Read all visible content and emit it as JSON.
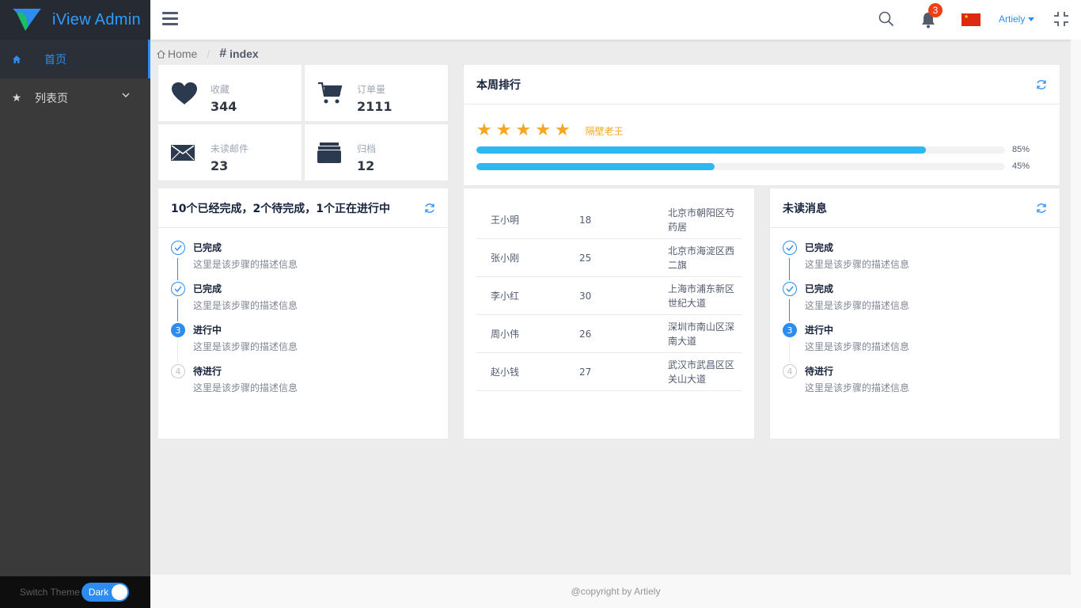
{
  "app": {
    "logo_text": "iView Admin"
  },
  "sidebar": {
    "items": [
      {
        "label": "首页",
        "icon": "home-icon",
        "active": true
      },
      {
        "label": "列表页",
        "icon": "star-icon",
        "active": false
      }
    ],
    "theme": {
      "label": "Switch Theme",
      "value": "Dark"
    }
  },
  "header": {
    "notification_count": "3",
    "user": "Artiely",
    "colors": {
      "accent": "#2d8cf0",
      "badge": "#ed4014"
    }
  },
  "breadcrumb": {
    "home": "Home",
    "current": "index"
  },
  "stats": [
    {
      "label": "收藏",
      "value": "344",
      "icon": "heart-icon"
    },
    {
      "label": "订单量",
      "value": "2111",
      "icon": "cart-icon"
    },
    {
      "label": "未读邮件",
      "value": "23",
      "icon": "mail-icon"
    },
    {
      "label": "归档",
      "value": "12",
      "icon": "archive-icon"
    }
  ],
  "ranking": {
    "title": "本周排行",
    "stars": 5,
    "name": "隔壁老王",
    "progress": [
      {
        "percent": 85,
        "text": "85%"
      },
      {
        "percent": 45,
        "text": "45%"
      }
    ]
  },
  "tasks": {
    "title": "10个已经完成，2个待完成，1个正在进行中",
    "steps": [
      {
        "title": "已完成",
        "desc": "这里是该步骤的描述信息",
        "status": "done"
      },
      {
        "title": "已完成",
        "desc": "这里是该步骤的描述信息",
        "status": "done"
      },
      {
        "title": "进行中",
        "desc": "这里是该步骤的描述信息",
        "status": "process",
        "num": "3"
      },
      {
        "title": "待进行",
        "desc": "这里是该步骤的描述信息",
        "status": "wait",
        "num": "4"
      }
    ]
  },
  "people": [
    {
      "name": "王小明",
      "age": "18",
      "address": "北京市朝阳区芍药居"
    },
    {
      "name": "张小刚",
      "age": "25",
      "address": "北京市海淀区西二旗"
    },
    {
      "name": "李小红",
      "age": "30",
      "address": "上海市浦东新区世纪大道"
    },
    {
      "name": "周小伟",
      "age": "26",
      "address": "深圳市南山区深南大道"
    },
    {
      "name": "赵小钱",
      "age": "27",
      "address": "武汉市武昌区区关山大道"
    }
  ],
  "messages": {
    "title": "未读消息",
    "steps": [
      {
        "title": "已完成",
        "desc": "这里是该步骤的描述信息",
        "status": "done"
      },
      {
        "title": "已完成",
        "desc": "这里是该步骤的描述信息",
        "status": "done"
      },
      {
        "title": "进行中",
        "desc": "这里是该步骤的描述信息",
        "status": "process",
        "num": "3"
      },
      {
        "title": "待进行",
        "desc": "这里是该步骤的描述信息",
        "status": "wait",
        "num": "4"
      }
    ]
  },
  "footer": {
    "text": "@copyright by Artiely"
  }
}
